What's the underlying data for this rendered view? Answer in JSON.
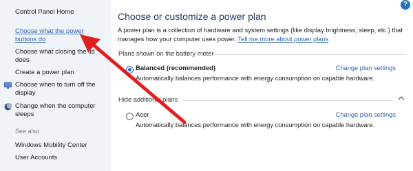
{
  "sidebar": {
    "items": [
      {
        "label": "Control Panel Home"
      },
      {
        "label": "Choose what the power buttons do"
      },
      {
        "label": "Choose what closing the lid does"
      },
      {
        "label": "Create a power plan"
      },
      {
        "label": "Choose when to turn off the display",
        "icon": "display-icon"
      },
      {
        "label": "Change when the computer sleeps",
        "icon": "moon-icon"
      }
    ],
    "see_also_label": "See also",
    "see_also": [
      {
        "label": "Windows Mobility Center"
      },
      {
        "label": "User Accounts"
      }
    ]
  },
  "main": {
    "help_label": "?",
    "title": "Choose or customize a power plan",
    "intro_text": "A power plan is a collection of hardware and system settings (like display brightness, sleep, etc.) that manages how your computer uses power.",
    "intro_link": "Tell me more about power plans",
    "battery_group_label": "Plans shown on the battery meter",
    "hidden_group_label": "Hide additional plans",
    "plans": [
      {
        "name": "Balanced (recommended)",
        "selected": true,
        "description": "Automatically balances performance with energy consumption on capable hardware.",
        "link": "Change plan settings"
      },
      {
        "name": "Acer",
        "selected": false,
        "description": "Automatically balances performance with energy consumption on capable hardware.",
        "link": "Change plan settings"
      }
    ]
  },
  "annotation": {
    "arrow_color": "#e02020",
    "points_to": "Choose what the power buttons do"
  },
  "colors": {
    "link": "#2d64b3",
    "title": "#1f3a68",
    "sidebar_bg": "#f0f4f9",
    "accent": "#1f6fc5"
  }
}
